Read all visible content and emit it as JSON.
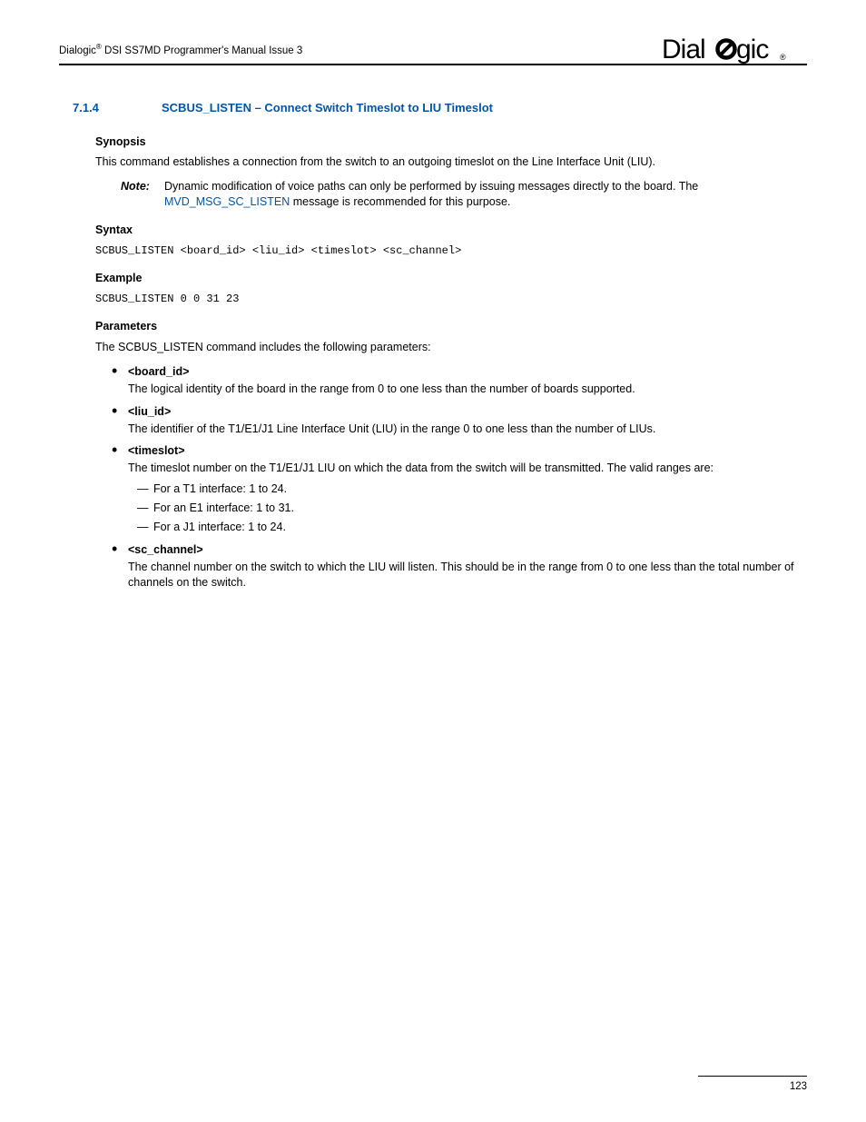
{
  "header": {
    "left_prefix": "Dialogic",
    "left_reg": "®",
    "left_suffix": " DSI SS7MD Programmer's Manual  Issue 3",
    "logo_text": "Dialogic",
    "logo_reg": "®"
  },
  "section": {
    "number": "7.1.4",
    "title": "SCBUS_LISTEN – Connect Switch Timeslot to LIU Timeslot"
  },
  "synopsis": {
    "heading": "Synopsis",
    "text": "This command establishes a connection from the switch to an outgoing timeslot on the Line Interface Unit (LIU)."
  },
  "note": {
    "label": "Note:",
    "pre": "Dynamic modification of voice paths can only be performed by issuing messages directly to the board. The ",
    "link": "MVD_MSG_SC_LISTEN",
    "post": " message is recommended for this purpose."
  },
  "syntax": {
    "heading": "Syntax",
    "code": "SCBUS_LISTEN <board_id> <liu_id> <timeslot> <sc_channel>"
  },
  "example": {
    "heading": "Example",
    "code": "SCBUS_LISTEN 0 0 31 23"
  },
  "parameters": {
    "heading": "Parameters",
    "intro": "The SCBUS_LISTEN command includes the following parameters:",
    "items": [
      {
        "name": "<board_id>",
        "desc": "The logical identity of the board in the range from 0 to one less than the number of boards supported."
      },
      {
        "name": "<liu_id>",
        "desc": "The identifier of the T1/E1/J1 Line Interface Unit (LIU) in the range 0 to one less than the number of LIUs."
      },
      {
        "name": "<timeslot>",
        "desc": "The timeslot number on the T1/E1/J1 LIU on which the data from the switch will be transmitted. The valid ranges are:",
        "sublist": [
          "For a T1 interface: 1 to 24.",
          "For an E1 interface: 1 to 31.",
          "For a J1 interface: 1 to 24."
        ]
      },
      {
        "name": "<sc_channel>",
        "desc": "The channel number on the switch to which the LIU will listen. This should be in the range from 0 to one less than the total number of channels on the switch."
      }
    ]
  },
  "footer": {
    "page_number": "123"
  }
}
